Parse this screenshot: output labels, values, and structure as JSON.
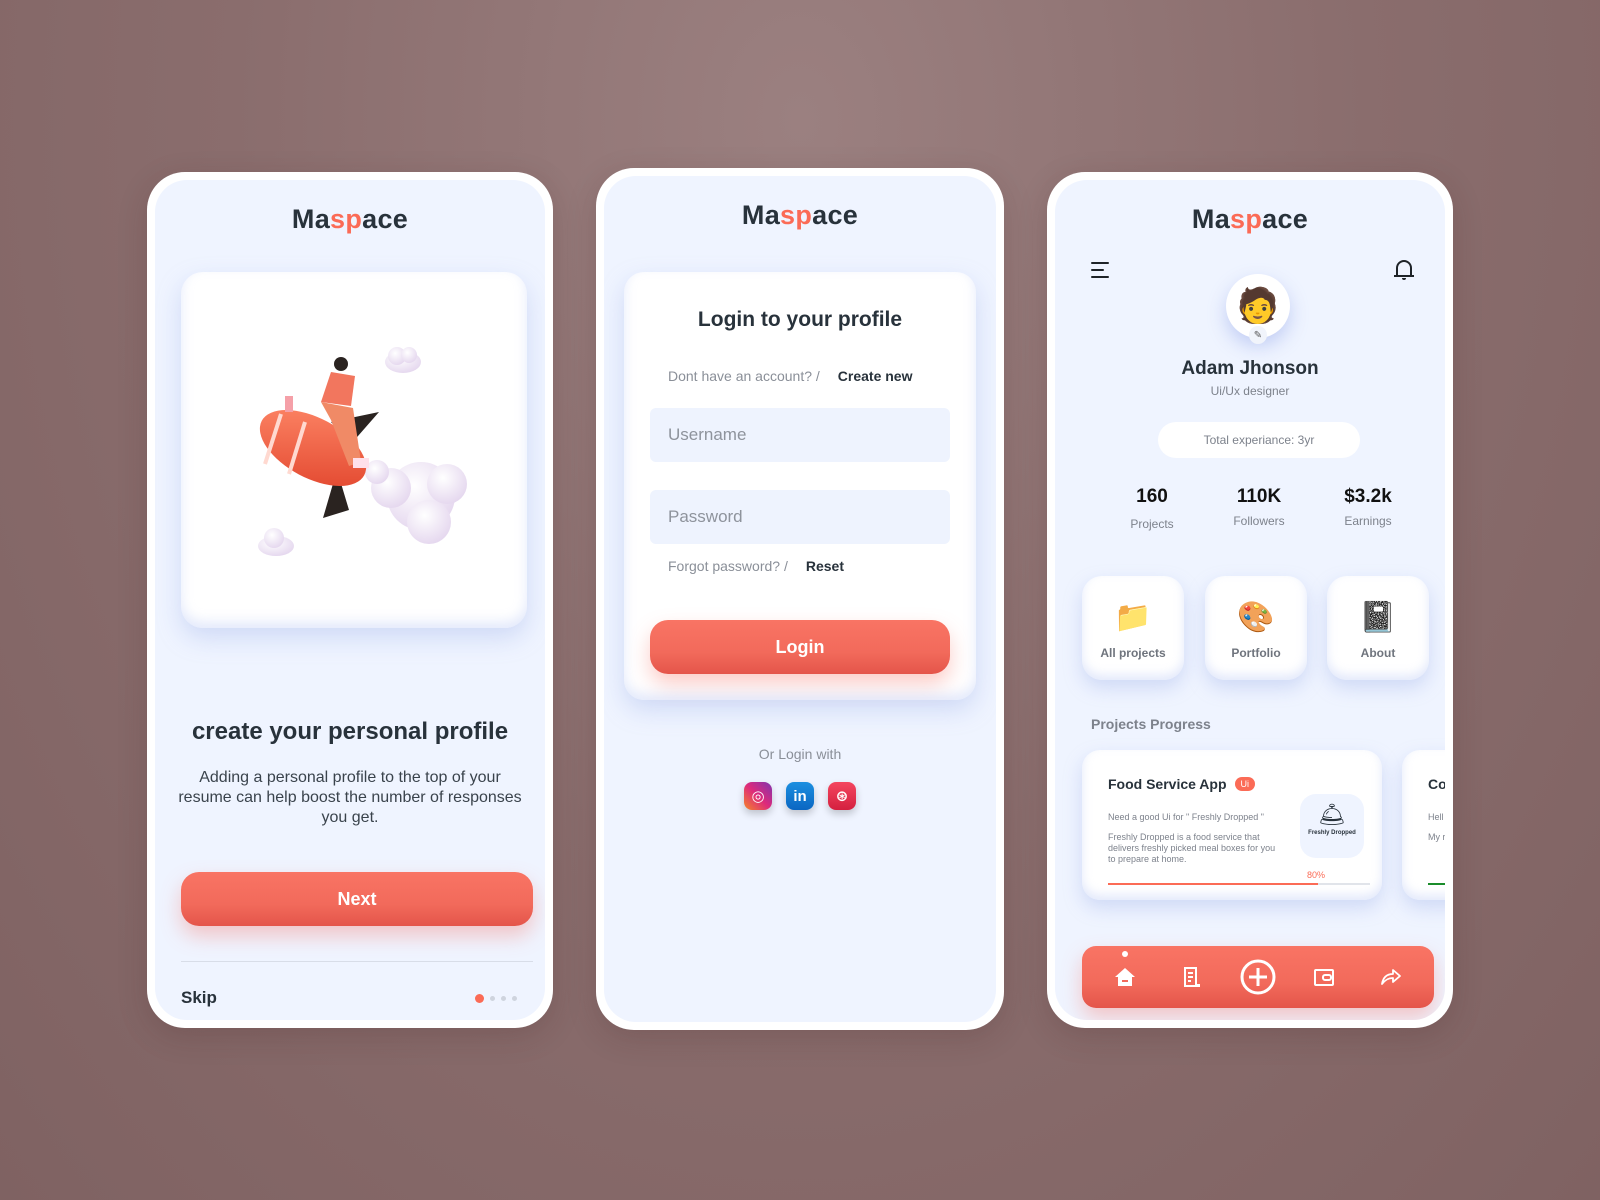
{
  "brand": {
    "prefix": "Ma",
    "accent": "sp",
    "suffix": "ace",
    "accent_color": "#fb6b56",
    "text_color": "#28323b"
  },
  "onboarding": {
    "illustration": "rocket-rider-illustration",
    "title": "create your personal profile",
    "description": "Adding a personal profile to the top of your resume can help boost the number of responses you get.",
    "next_label": "Next",
    "skip_label": "Skip",
    "pagination": {
      "total": 4,
      "active": 1
    }
  },
  "login": {
    "title": "Login to your profile",
    "no_account_text": "Dont have an account? /",
    "create_new_label": "Create new",
    "username_placeholder": "Username",
    "password_placeholder": "Password",
    "forgot_text": "Forgot password? /",
    "reset_label": "Reset",
    "login_label": "Login",
    "or_login_with": "Or Login with",
    "socials": [
      {
        "name": "instagram",
        "glyph": "◎"
      },
      {
        "name": "linkedin",
        "glyph": "in"
      },
      {
        "name": "dribbble",
        "glyph": "⊛"
      }
    ]
  },
  "profile": {
    "avatar_glyph": "🧑",
    "name": "Adam Jhonson",
    "role": "Ui/Ux designer",
    "experience": "Total experiance: 3yr",
    "stats": [
      {
        "value": "160",
        "label": "Projects"
      },
      {
        "value": "110K",
        "label": "Followers"
      },
      {
        "value": "$3.2k",
        "label": "Earnings"
      }
    ],
    "tiles": [
      {
        "icon": "📁",
        "label": "All  projects"
      },
      {
        "icon": "🎨",
        "label": "Portfolio"
      },
      {
        "icon": "📓",
        "label": "About"
      }
    ],
    "section_title": "Projects Progress",
    "projects": [
      {
        "title": "Food Service App",
        "badge": "Ui",
        "subtitle": "Need a good Ui for \" Freshly Dropped \"",
        "description": "Freshly Dropped is a food service that delivers freshly picked meal boxes for you to prepare at home.",
        "logo_text": "Freshly Dropped",
        "logo_glyph": "🛎",
        "progress_label": "80%",
        "progress": 0.8
      },
      {
        "title": "Co",
        "subtitle": "Hell",
        "description": "My r I wo cont",
        "progress": 0.1
      }
    ],
    "nav": [
      {
        "name": "home",
        "active": true
      },
      {
        "name": "document"
      },
      {
        "name": "add"
      },
      {
        "name": "wallet"
      },
      {
        "name": "share"
      }
    ]
  }
}
